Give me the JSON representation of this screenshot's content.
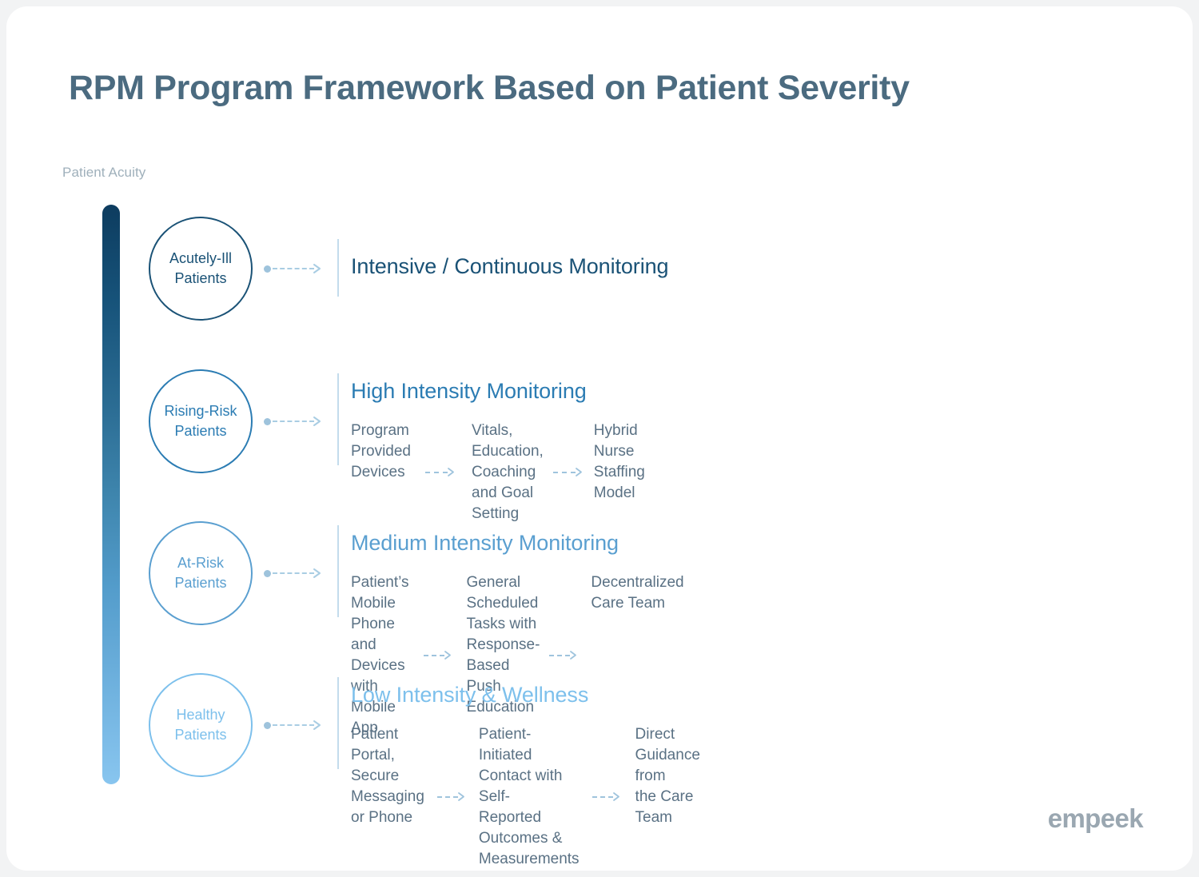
{
  "page": {
    "title": "RPM Program Framework Based on Patient Severity",
    "axis_label": "Patient Acuity",
    "brand": "empeek"
  },
  "colors": {
    "title": "#4b6b80",
    "axis_label": "#9fb0bb",
    "body_text": "#5a7184",
    "gradient_top": "#0d3c5f",
    "gradient_bottom": "#88c5ef",
    "divider": "#c3dcec",
    "connector": "#a9cde3",
    "brand": "#9aa7b1"
  },
  "rows": [
    {
      "circle_label_line1": "Acutely-Ill",
      "circle_label_line2": "Patients",
      "heading": "Intensive / Continuous Monitoring",
      "accent": "#1a5276",
      "steps": []
    },
    {
      "circle_label_line1": "Rising-Risk",
      "circle_label_line2": "Patients",
      "heading": "High Intensity Monitoring",
      "accent": "#2b7cb3",
      "steps": [
        "Program\nProvided Devices",
        "Vitals, Education, Coaching\nand Goal Setting",
        "Hybrid Nurse\nStaffing Model"
      ]
    },
    {
      "circle_label_line1": "At-Risk",
      "circle_label_line2": "Patients",
      "heading": "Medium Intensity Monitoring",
      "accent": "#5a9fd0",
      "steps": [
        "Patient’s Mobile Phone and\nDevices with Mobile App",
        "General Scheduled Tasks with\nResponse-Based Push Education",
        "Decentralized\nCare Team"
      ]
    },
    {
      "circle_label_line1": "Healthy",
      "circle_label_line2": "Patients",
      "heading": "Low Intensity & Wellness",
      "accent": "#7dc0ec",
      "steps": [
        "Patient Portal, Secure\nMessaging or Phone",
        "Patient-Initiated Contact with Self-\nReported Outcomes & Measurements",
        "Direct Guidance from\nthe Care Team"
      ]
    }
  ]
}
